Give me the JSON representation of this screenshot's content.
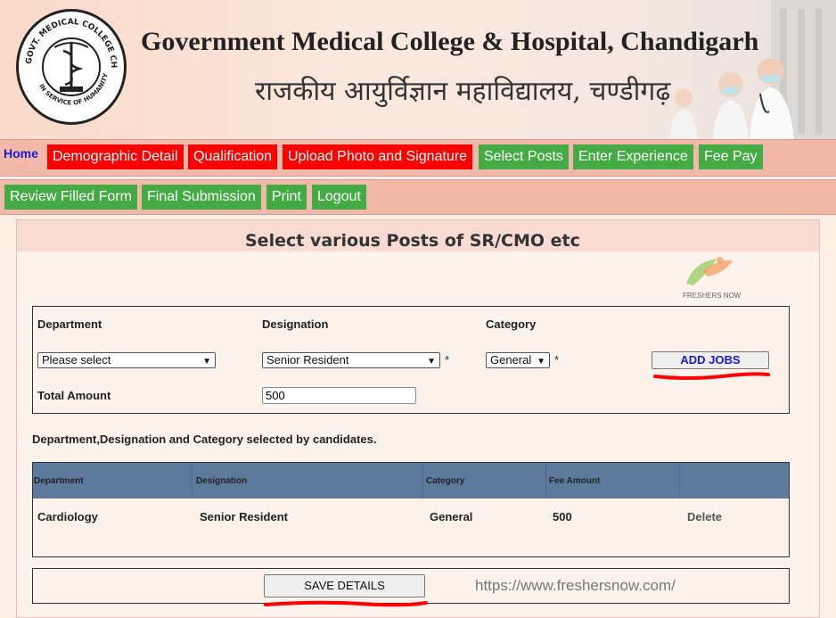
{
  "header": {
    "title_en": "Government Medical College & Hospital, Chandigarh",
    "title_hi": "राजकीय आयुर्विज्ञान महाविद्यालय, चण्डीगढ़",
    "logo_text_top": "GOVT. MEDICAL COLLEGE CHANDIGARH",
    "logo_text_bottom": "IN SERVICE OF HUMANITY"
  },
  "nav": {
    "home": "Home",
    "row1": [
      {
        "label": "Demographic Detail",
        "color": "#ff0000"
      },
      {
        "label": "Qualification",
        "color": "#ff0000"
      },
      {
        "label": "Upload Photo and Signature",
        "color": "#ff0000"
      },
      {
        "label": "Select Posts",
        "color": "#44aa44"
      },
      {
        "label": "Enter Experience",
        "color": "#44aa44"
      },
      {
        "label": "Fee Pay",
        "color": "#44aa44"
      }
    ],
    "row2": [
      {
        "label": "Review Filled Form"
      },
      {
        "label": "Final Submission"
      },
      {
        "label": "Print"
      },
      {
        "label": "Logout"
      }
    ]
  },
  "panel": {
    "title": "Select various Posts of SR/CMO etc",
    "watermark_logo_text": "FRESHERS NOW"
  },
  "form": {
    "department_label": "Department",
    "designation_label": "Designation",
    "category_label": "Category",
    "department_value": "Please select",
    "designation_value": "Senior Resident",
    "category_value": "General",
    "required_mark": "*",
    "add_jobs": "ADD JOBS",
    "total_amount_label": "Total Amount",
    "total_amount_value": "500"
  },
  "selected": {
    "caption": "Department,Designation and Category selected by candidates.",
    "columns": [
      "Department",
      "Designation",
      "Category",
      "Fee Amount"
    ],
    "rows": [
      {
        "department": "Cardiology",
        "designation": "Senior Resident",
        "category": "General",
        "fee": "500",
        "action": "Delete"
      }
    ]
  },
  "save": {
    "label": "SAVE DETAILS",
    "watermark_url": "https://www.freshersnow.com/"
  },
  "colors": {
    "nav_bg": "#f2b8a9",
    "red_tab": "#ff0000",
    "green_tab": "#44aa44",
    "table_header": "#5d7a9c",
    "annotation": "#ff0000"
  }
}
